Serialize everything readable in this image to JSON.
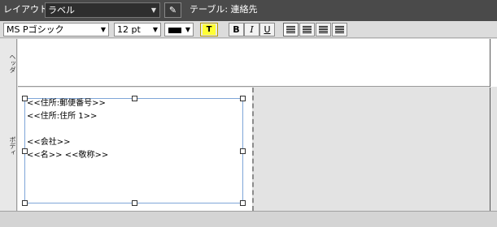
{
  "toolbar": {
    "layout_label": "レイアウト:",
    "layout_value": "ラベル",
    "table_label": "テーブル: 連絡先"
  },
  "format_bar": {
    "font": "MS Pゴシック",
    "size": "12 pt",
    "text_color": "#000000",
    "highlight_label": "T",
    "highlight_color": "#ffff33",
    "bold": "B",
    "italic": "I",
    "underline": "U"
  },
  "parts": {
    "header": "ヘッダ",
    "body": "ボディ"
  },
  "label_object": {
    "lines": [
      "<<住所:郵便番号>>",
      "<<住所:住所 1>>",
      "",
      "<<会社>>",
      "<<名>>  <<敬称>>"
    ]
  },
  "colors": {
    "toolbar_bg": "#4a4a4a",
    "selection_border": "#7fa6d8"
  }
}
